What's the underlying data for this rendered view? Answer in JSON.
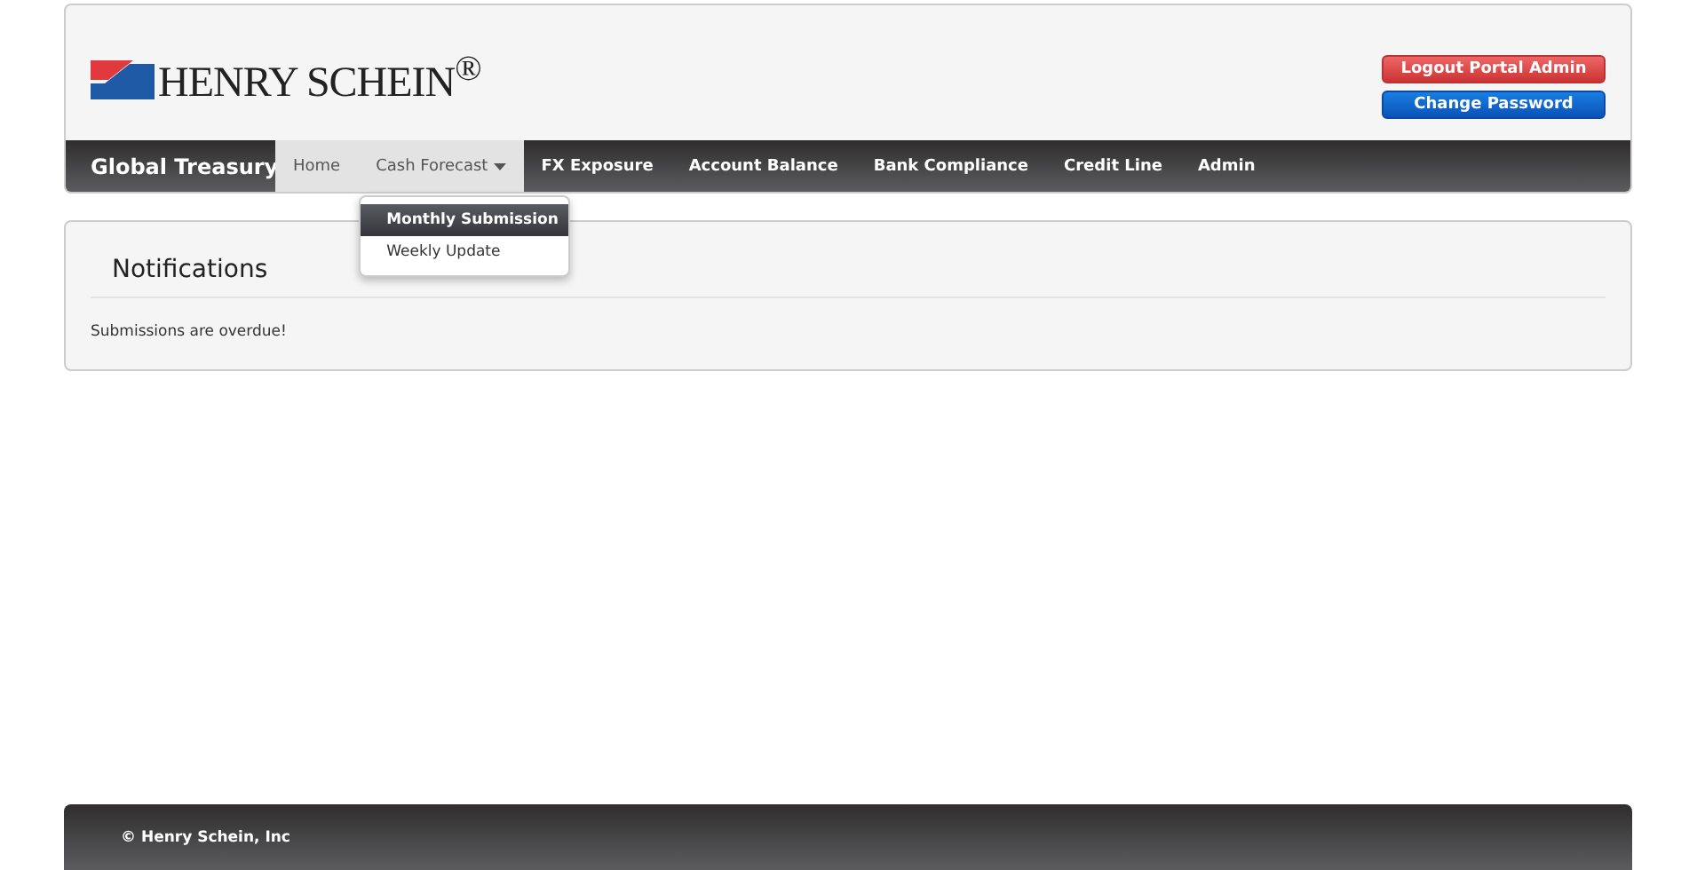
{
  "header": {
    "logo": "HENRY SCHEIN$^{®}$",
    "buttons": [
      {
        "label": "Logout Portal Admin",
        "kind": "danger"
      },
      {
        "label": "Change Password",
        "kind": "primary"
      }
    ]
  },
  "nav": {
    "brand": "Global Treasury",
    "items": [
      {
        "label": "Home",
        "highlighted": true
      },
      {
        "label": "Cash Forecast",
        "highlighted": true,
        "menu": [
          {
            "label": "Monthly Submission",
            "selected": true
          },
          {
            "label": "Weekly Update",
            "selected": false
          }
        ]
      },
      {
        "label": "FX Exposure",
        "highlighted": false
      },
      {
        "label": "Account Balance",
        "highlighted": false
      },
      {
        "label": "Bank Compliance",
        "highlighted": false
      },
      {
        "label": "Credit Line",
        "highlighted": false
      },
      {
        "label": "Admin",
        "highlighted": false
      }
    ]
  },
  "panel": {
    "title": "Notifications",
    "message": "Submissions are overdue!"
  },
  "footer": "© Henry Schein, Inc"
}
